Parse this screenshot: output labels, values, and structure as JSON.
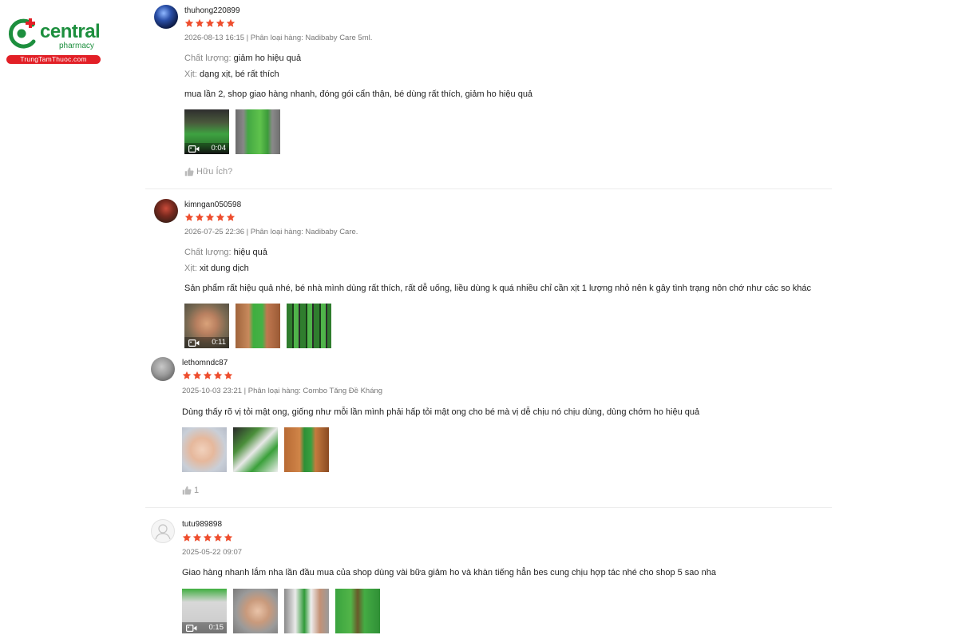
{
  "brand": {
    "name": "central",
    "sub": "pharmacy",
    "url": "TrungTamThuoc.com",
    "colors": {
      "green": "#1d8f3e",
      "red": "#e21f26"
    }
  },
  "star_color": "#ee4d2d",
  "reviews": [
    {
      "username": "thuhong220899",
      "rating": 5,
      "meta": "2026-08-13 16:15 | Phân loại hàng: Nadibaby Care 5ml.",
      "attributes": [
        {
          "key": "Chất lượng:",
          "value": "giảm ho hiệu quả"
        },
        {
          "key": "Xịt:",
          "value": "dạng xịt, bé rất thích"
        }
      ],
      "text": "mua lần 2, shop giao hàng nhanh, đóng gói cẩn thận, bé dùng rất thích, giảm ho hiệu quả",
      "video_duration": "0:04",
      "helpful_label": "Hữu Ích?"
    },
    {
      "username": "kimngan050598",
      "rating": 5,
      "meta": "2026-07-25 22:36 | Phân loại hàng: Nadibaby Care.",
      "attributes": [
        {
          "key": "Chất lượng:",
          "value": "hiệu quả"
        },
        {
          "key": "Xịt:",
          "value": "xit dung dịch"
        }
      ],
      "text": "Sản phẩm rất hiệu quả nhé, bé nhà mình dùng rất thích, rất dễ uống, liều dùng k quá nhiều chỉ cần xịt 1 lượng nhỏ nên k gây tình trạng nôn chớ như các so khác",
      "video_duration": "0:11"
    },
    {
      "username": "lethomndc87",
      "rating": 5,
      "meta": "2025-10-03 23:21 | Phân loại hàng: Combo Tăng Đề Kháng",
      "text": "Dùng thấy rõ vị tỏi mật ong, giống như mỗi lần mình phải hấp tỏi mật ong cho bé mà vị dễ chịu nó chịu dùng, dùng chớm ho hiệu quả",
      "helpful_count": "1"
    },
    {
      "username": "tutu989898",
      "rating": 5,
      "meta": "2025-05-22 09:07",
      "text": "Giao hàng nhanh lắm nha lần đầu mua của shop dùng vài bữa giảm ho và khàn tiếng hẳn  bes cung chịu hợp tác nhé cho shop 5 sao nha",
      "video_duration": "0:15"
    }
  ],
  "icons": [
    "star-icon",
    "video-camera-icon",
    "thumbs-up-icon",
    "default-avatar-icon"
  ]
}
